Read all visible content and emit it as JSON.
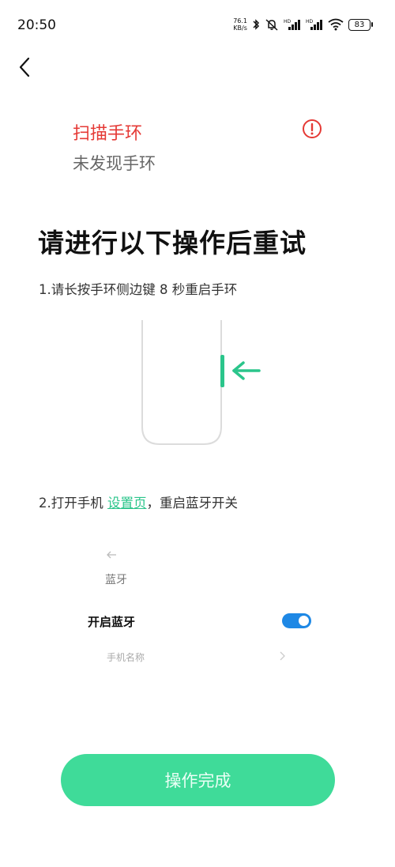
{
  "status_bar": {
    "time": "20:50",
    "net_speed_value": "76.1",
    "net_speed_unit": "KB/s",
    "battery": "83"
  },
  "scan": {
    "title": "扫描手环",
    "subtitle": "未发现手环"
  },
  "heading": "请进行以下操作后重试",
  "step1": "1.请长按手环侧边键 8 秒重启手环",
  "step2": {
    "prefix": "2.打开手机 ",
    "link": "设置页",
    "suffix": "，重启蓝牙开关"
  },
  "settings_preview": {
    "title": "蓝牙",
    "bluetooth_label": "开启蓝牙",
    "bluetooth_on": true,
    "phone_name_label": "手机名称"
  },
  "done_button": "操作完成",
  "colors": {
    "error": "#e53935",
    "accent": "#2bc58b",
    "button": "#3fdb99",
    "toggle": "#1e88e5"
  }
}
